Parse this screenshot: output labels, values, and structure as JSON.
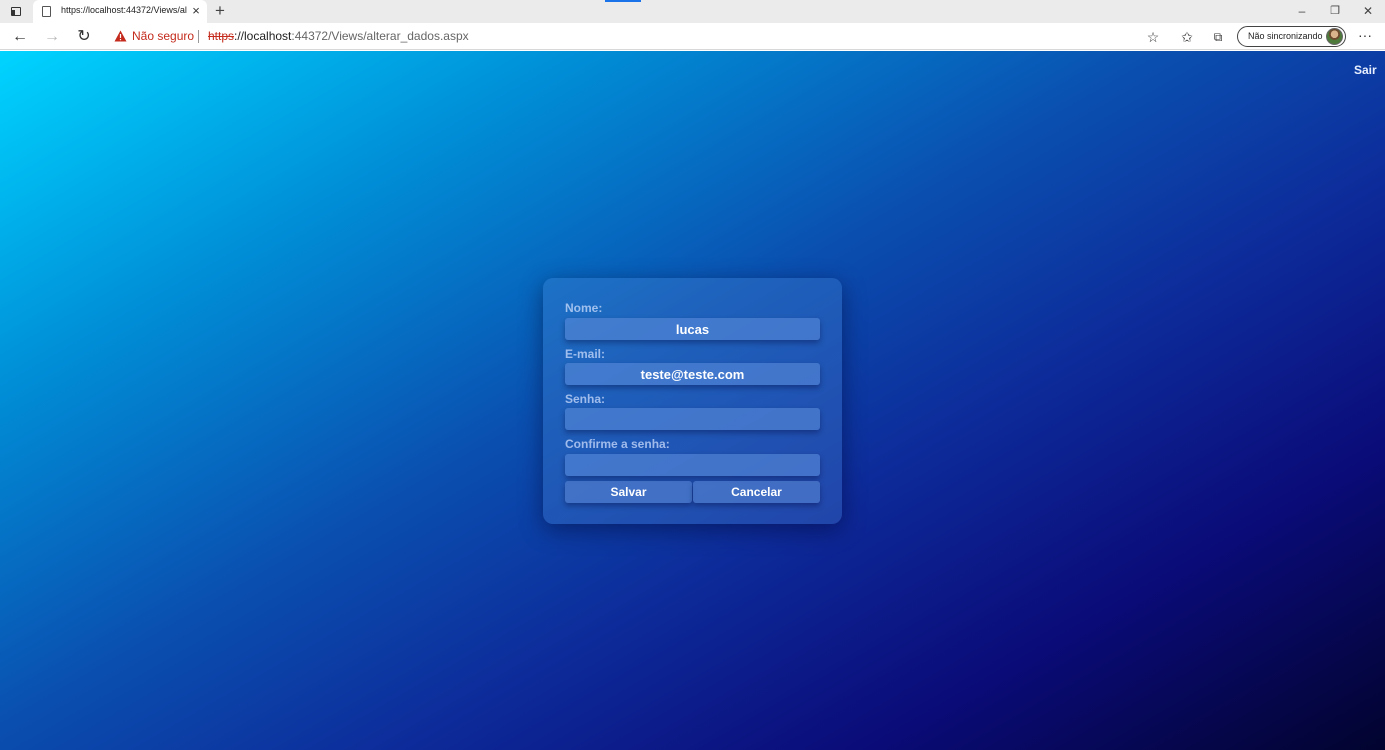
{
  "browser": {
    "tab_title": "https://localhost:44372/Views/alterar_dados.aspx",
    "tab_icon": "page-icon",
    "security_label": "Não seguro",
    "url_scheme": "https",
    "url_host": "://localhost",
    "url_rest": ":44372/Views/alterar_dados.aspx",
    "profile_label": "Não sincronizando",
    "icons": [
      "back-icon",
      "forward-icon",
      "refresh-icon",
      "warning-icon",
      "add-favorite-icon",
      "favorites-icon",
      "collections-icon",
      "more-icon"
    ]
  },
  "header": {
    "logout_label": "Sair"
  },
  "form": {
    "name_label": "Nome:",
    "name_value": "lucas",
    "email_label": "E-mail:",
    "email_value": "teste@teste.com",
    "password_label": "Senha:",
    "password_value": "",
    "confirm_label": "Confirme a senha:",
    "confirm_value": "",
    "save_label": "Salvar",
    "cancel_label": "Cancelar"
  },
  "colors": {
    "gradient_start": "#00d4ff",
    "gradient_end": "#02032e",
    "insecure_red": "#c42b1c"
  }
}
